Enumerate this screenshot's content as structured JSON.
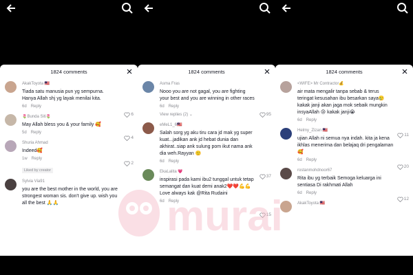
{
  "colors": {
    "accent_pink": "#fe2c55",
    "text": "#161823",
    "muted": "#8a8b91",
    "watermark": "#f4b9c6"
  },
  "watermark": {
    "text": "murai"
  },
  "panels": [
    {
      "title": "1824 comments",
      "comments": [
        {
          "user": "AkakToyota 🇲🇾",
          "text": "Tiada satu manusia pun yg sempurna. Hanya Allah shj yg layak menilai kita.",
          "time": "6d",
          "reply": "Reply",
          "likes": "6",
          "avatar_color": "#c9a58f"
        },
        {
          "user": "🌷Bunda Siti🌷",
          "text": "May Allah bless you & your family 🥰",
          "time": "5d",
          "reply": "Reply",
          "likes": "4",
          "avatar_color": "#c6b7a8"
        },
        {
          "user": "Shuria Ahmad",
          "text": "Indeed🥰",
          "time": "1w",
          "reply": "Reply",
          "likes": "2",
          "badge": "Liked by creator",
          "avatar_color": "#b8a7b8"
        },
        {
          "user": "Sylvia Via91",
          "text": "you are the best mother in the world, you are strongest woman sis. don't give up. wish you all the best 🙏🙏",
          "time": "",
          "reply": "",
          "likes": "",
          "avatar_color": "#4a4040"
        }
      ]
    },
    {
      "title": "1824 comments",
      "comments": [
        {
          "user": "Asma Fras",
          "text": "Nooo you are not gagal, you are fighting your best and you are winning in other races",
          "time": "6d",
          "reply": "Reply",
          "likes": "95",
          "avatar_color": "#6b86a8"
        },
        {
          "user": "eMeL1_6🇲🇾",
          "text": "Salah sorg yg aku tiru cara jd mak yg super kuat...jadikan ank jd hebat dunia dan akhirat..siap ank sulung pom ikut nama ank dia weh.Rayyan 🙂",
          "time": "6d",
          "reply": "Reply",
          "likes": "37",
          "avatar_color": "#8c5a4a"
        },
        {
          "user": "EkaLalita 💗",
          "text": "inspirasi pada kami ibu2 tunggal untuk tetap semangat dan kuat demi anak2❤️❤️💪💪 Love always kak @Rita Rudaini",
          "time": "6d",
          "reply": "Reply",
          "likes": "15",
          "avatar_color": "#6a8a5a"
        }
      ],
      "view_replies": "View replies (2)"
    },
    {
      "title": "1824 comments",
      "comments": [
        {
          "user": "<WIFE> Mr Contractor💰",
          "text": "air mata mengalir tanpa sebab & terus teringat kesusahan ibu besarkan saya🥲 kakak janji akan jaga mok sebaik mungkin insyaAllah 😢 kakak janji😭",
          "time": "6d",
          "reply": "Reply",
          "likes": "11",
          "avatar_color": "#b7a29c"
        },
        {
          "user": "Helmy_Zizan 🇲🇾",
          "text": "ujian Allah ni semua nya indah. kita ja kena ikhlas menerima dan belajaq dri pengalaman🥰",
          "time": "6d",
          "reply": "Reply",
          "likes": "20",
          "avatar_color": "#2b3f7a"
        },
        {
          "user": "rostanmohdnoor67",
          "text": "Rita ibu yg terbaik Semoga keluarga ini sentiasa Di rakhmati Allah",
          "time": "6d",
          "reply": "Reply",
          "likes": "12",
          "avatar_color": "#5a4a48"
        },
        {
          "user": "AkakToyota 🇲🇾",
          "text": "",
          "time": "",
          "reply": "",
          "likes": "",
          "avatar_color": "#c9a58f"
        }
      ]
    }
  ]
}
